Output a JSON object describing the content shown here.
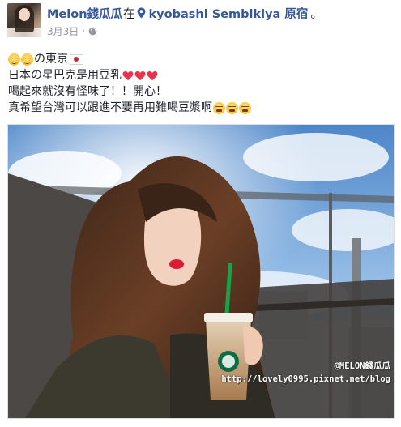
{
  "post": {
    "author": "Melon錢瓜瓜",
    "at_text": "在",
    "location": "kyobashi Sembikiya 原宿",
    "location_suffix": "。",
    "date": "3月3日",
    "meta_separator": "·",
    "audience_icon": "globe-icon",
    "body": {
      "line1_text": "の東京",
      "line2_text": "日本の星巴克是用豆乳",
      "line3_text": "喝起來就沒有怪味了！！開心！",
      "line4_text": "真希望台灣可以跟進不要再用難喝豆漿啊"
    },
    "photo": {
      "watermark_line1": "@MELON錢瓜瓜",
      "watermark_line2": "http://lovely0995.pixnet.net/blog"
    }
  },
  "colors": {
    "link_blue": "#365899",
    "text": "#1d2129",
    "meta_gray": "#90949c",
    "heart_red": "#e8334f"
  }
}
